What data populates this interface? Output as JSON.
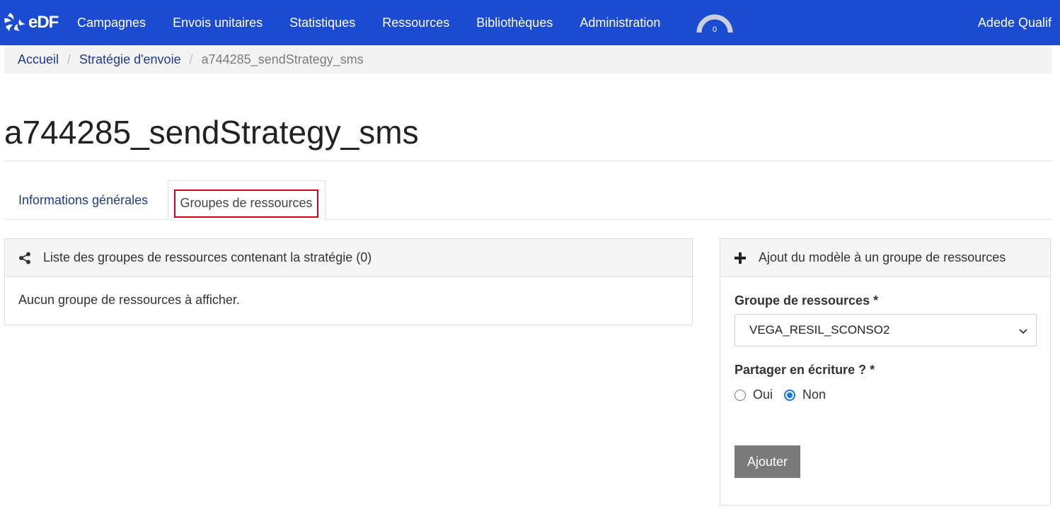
{
  "navbar": {
    "logo_text": "eDF",
    "items": [
      "Campagnes",
      "Envois unitaires",
      "Statistiques",
      "Ressources",
      "Bibliothèques",
      "Administration"
    ],
    "gauge_value": "0",
    "user": "Adede Qualif",
    "background": "#1a4bd0"
  },
  "breadcrumb": {
    "home": "Accueil",
    "section": "Stratégie d'envoie",
    "current": "a744285_sendStrategy_sms",
    "separator": "/"
  },
  "page": {
    "title": "a744285_sendStrategy_sms"
  },
  "tabs": {
    "info": "Informations générales",
    "groups": "Groupes de ressources",
    "active": "Groupes de ressources"
  },
  "list_panel": {
    "icon": "share-nodes-icon",
    "heading": "Liste des groupes de ressources contenant la stratégie (0)",
    "empty_text": "Aucun groupe de ressources à afficher."
  },
  "add_panel": {
    "icon": "plus-icon",
    "heading": "Ajout du modèle à un groupe de ressources",
    "group_label": "Groupe de ressources *",
    "group_value": "VEGA_RESIL_SCONSO2",
    "share_label": "Partager en écriture ? *",
    "option_yes": "Oui",
    "option_no": "Non",
    "selected_option": "Non",
    "submit": "Ajouter"
  }
}
